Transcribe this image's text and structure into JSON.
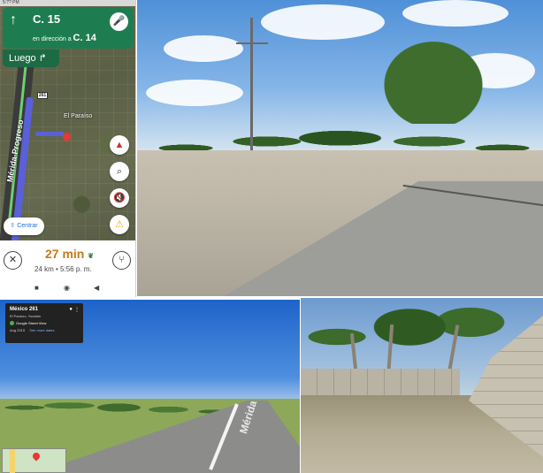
{
  "phone": {
    "status_time": "5:?? PM",
    "nav": {
      "turn_icon": "↑",
      "street": "C. 15",
      "direction_prefix": "en dirección a",
      "direction_street": "C. 14",
      "mic_icon": "microphone-icon"
    },
    "next_step": {
      "label": "Luego",
      "icon": "↱"
    },
    "map": {
      "highway_number": "261",
      "place_label": "El Paraíso",
      "street_label": "Mérida-Progreso"
    },
    "buttons": {
      "compass": "▲",
      "search": "⌕",
      "mute": "🔇",
      "alert": "⚠",
      "center": "Centrar",
      "center_icon": "⇧"
    },
    "trip": {
      "eta": "27 min",
      "eco_icon": "❦",
      "details": "24 km • 5:56 p. m.",
      "close_icon": "✕",
      "routes_icon": "⑂"
    },
    "system_nav": {
      "recent": "■",
      "home": "◉",
      "back": "◀"
    }
  },
  "street_view": {
    "title": "México 261",
    "subtitle": "El Paraíso, Yucatán",
    "provider": "Google Street View",
    "date": "Aug 2015",
    "see_more": "See more dates",
    "road_text": "Mérida",
    "info_icon": "●",
    "more_icon": "⋮"
  },
  "colors": {
    "nav_green": "#1e7d50",
    "route_blue": "#5a60d8",
    "eta_orange": "#c5791a",
    "pin_red": "#e53935"
  }
}
